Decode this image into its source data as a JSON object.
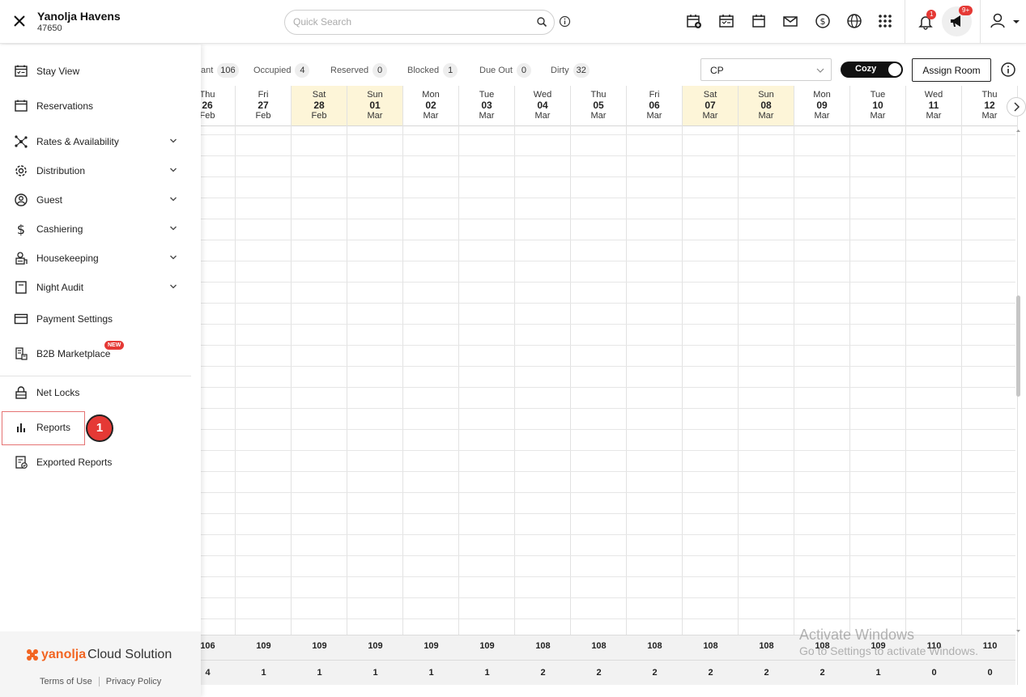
{
  "header": {
    "hotel_name": "Yanolja Havens",
    "hotel_id": "47650",
    "search_placeholder": "Quick Search",
    "notification_count": "1",
    "announcement_count": "9+"
  },
  "sidebar": {
    "items": [
      {
        "label": "Stay View",
        "icon": "calendar-check-icon",
        "expandable": false
      },
      {
        "label": "Reservations",
        "icon": "calendar-icon",
        "expandable": false
      },
      {
        "label": "Rates & Availability",
        "icon": "network-icon",
        "expandable": true
      },
      {
        "label": "Distribution",
        "icon": "gear-icon",
        "expandable": true
      },
      {
        "label": "Guest",
        "icon": "guest-icon",
        "expandable": true
      },
      {
        "label": "Cashiering",
        "icon": "dollar-icon",
        "expandable": true
      },
      {
        "label": "Housekeeping",
        "icon": "housekeeping-icon",
        "expandable": true
      },
      {
        "label": "Night Audit",
        "icon": "document-icon",
        "expandable": true
      },
      {
        "label": "Payment Settings",
        "icon": "card-icon",
        "expandable": false
      },
      {
        "label": "B2B Marketplace",
        "icon": "marketplace-icon",
        "expandable": false,
        "badge": "NEW"
      },
      {
        "label": "Net Locks",
        "icon": "lock-icon",
        "expandable": false
      },
      {
        "label": "Reports",
        "icon": "bar-chart-icon",
        "expandable": false
      },
      {
        "label": "Exported Reports",
        "icon": "exported-report-icon",
        "expandable": false
      }
    ],
    "step_marker": "1",
    "footer": {
      "brand_first": "yanolja",
      "brand_second": "Cloud Solution",
      "terms": "Terms of Use",
      "privacy": "Privacy Policy"
    }
  },
  "legend": [
    {
      "label": "ant",
      "count": "106"
    },
    {
      "label": "Occupied",
      "count": "4"
    },
    {
      "label": "Reserved",
      "count": "0"
    },
    {
      "label": "Blocked",
      "count": "1"
    },
    {
      "label": "Due Out",
      "count": "0"
    },
    {
      "label": "Dirty",
      "count": "32"
    }
  ],
  "toolbar": {
    "rate_plan": "CP",
    "view_mode": "Cozy",
    "assign_label": "Assign Room"
  },
  "dates": [
    {
      "dow": "Thu",
      "day": "26",
      "mon": "Feb",
      "weekend": false,
      "available": "106",
      "occupied": "4"
    },
    {
      "dow": "Fri",
      "day": "27",
      "mon": "Feb",
      "weekend": false,
      "available": "109",
      "occupied": "1"
    },
    {
      "dow": "Sat",
      "day": "28",
      "mon": "Feb",
      "weekend": true,
      "available": "109",
      "occupied": "1"
    },
    {
      "dow": "Sun",
      "day": "01",
      "mon": "Mar",
      "weekend": true,
      "available": "109",
      "occupied": "1"
    },
    {
      "dow": "Mon",
      "day": "02",
      "mon": "Mar",
      "weekend": false,
      "available": "109",
      "occupied": "1"
    },
    {
      "dow": "Tue",
      "day": "03",
      "mon": "Mar",
      "weekend": false,
      "available": "109",
      "occupied": "1"
    },
    {
      "dow": "Wed",
      "day": "04",
      "mon": "Mar",
      "weekend": false,
      "available": "108",
      "occupied": "2"
    },
    {
      "dow": "Thu",
      "day": "05",
      "mon": "Mar",
      "weekend": false,
      "available": "108",
      "occupied": "2"
    },
    {
      "dow": "Fri",
      "day": "06",
      "mon": "Mar",
      "weekend": false,
      "available": "108",
      "occupied": "2"
    },
    {
      "dow": "Sat",
      "day": "07",
      "mon": "Mar",
      "weekend": true,
      "available": "108",
      "occupied": "2"
    },
    {
      "dow": "Sun",
      "day": "08",
      "mon": "Mar",
      "weekend": true,
      "available": "108",
      "occupied": "2"
    },
    {
      "dow": "Mon",
      "day": "09",
      "mon": "Mar",
      "weekend": false,
      "available": "108",
      "occupied": "2"
    },
    {
      "dow": "Tue",
      "day": "10",
      "mon": "Mar",
      "weekend": false,
      "available": "109",
      "occupied": "1"
    },
    {
      "dow": "Wed",
      "day": "11",
      "mon": "Mar",
      "weekend": false,
      "available": "110",
      "occupied": "0"
    },
    {
      "dow": "Thu",
      "day": "12",
      "mon": "Mar",
      "weekend": false,
      "available": "110",
      "occupied": "0"
    }
  ],
  "watermark": {
    "line1": "Activate Windows",
    "line2": "Go to Settings to activate Windows."
  },
  "colors": {
    "accent": "#e53935",
    "brand_orange": "#f26522",
    "weekend": "#fdf5d8"
  }
}
